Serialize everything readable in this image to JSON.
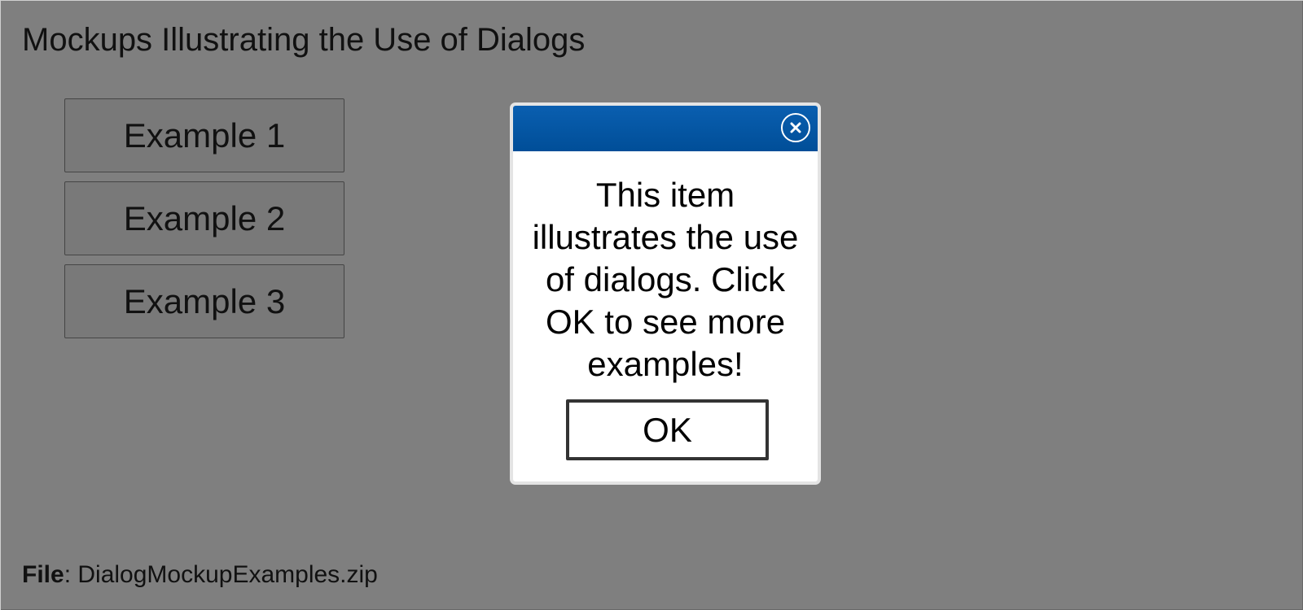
{
  "page": {
    "title": "Mockups Illustrating the Use of Dialogs"
  },
  "examples": [
    {
      "label": "Example 1"
    },
    {
      "label": "Example 2"
    },
    {
      "label": "Example 3"
    }
  ],
  "file": {
    "label": "File",
    "separator": ": ",
    "name": "DialogMockupExamples.zip"
  },
  "dialog": {
    "message": "This item illustrates the use of dialogs. Click OK to see more examples!",
    "ok_label": "OK",
    "close_icon": "close-icon"
  },
  "colors": {
    "titlebar": "#0a5fb0",
    "overlay": "rgba(0,0,0,0.5)"
  }
}
